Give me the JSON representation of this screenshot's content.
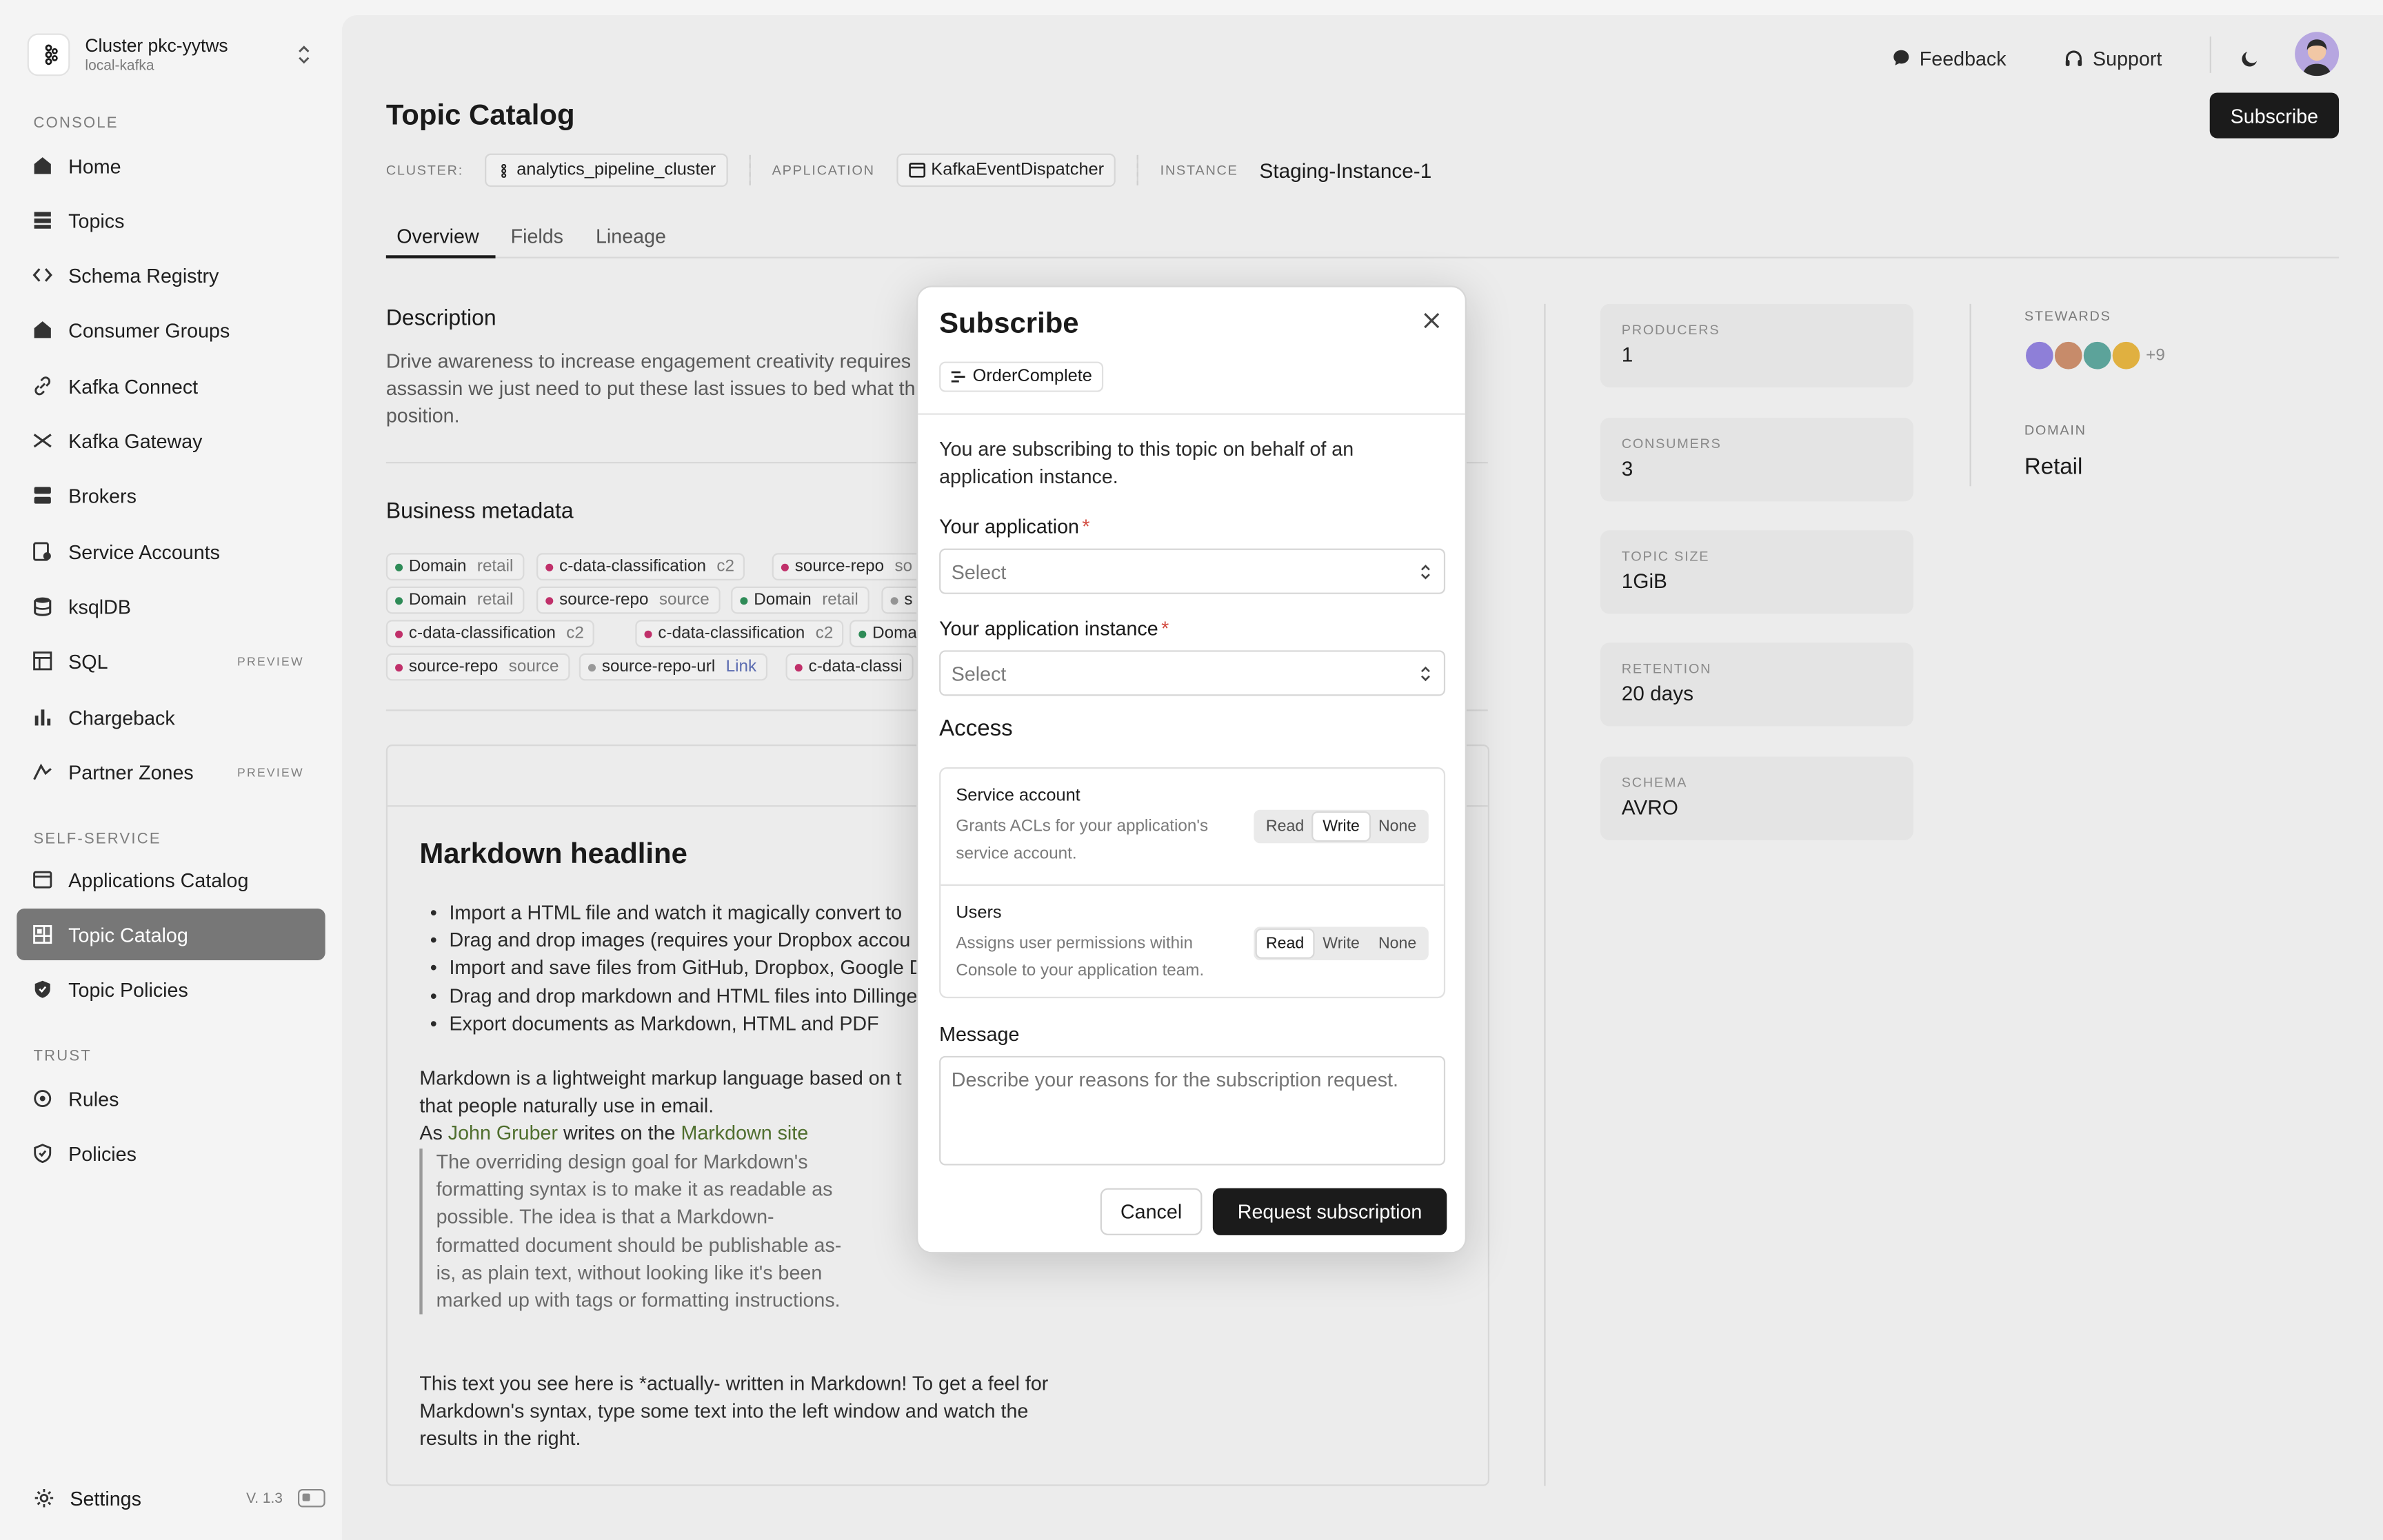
{
  "sidebar": {
    "cluster_name": "Cluster pkc-yytws",
    "cluster_sub": "local-kafka",
    "section_console": "CONSOLE",
    "section_self_service": "SELF-SERVICE",
    "section_trust": "TRUST",
    "items": [
      {
        "label": "Home",
        "icon": "home-icon"
      },
      {
        "label": "Topics",
        "icon": "topics-icon"
      },
      {
        "label": "Schema Registry",
        "icon": "code-icon"
      },
      {
        "label": "Consumer Groups",
        "icon": "home-icon"
      },
      {
        "label": "Kafka Connect",
        "icon": "link-icon"
      },
      {
        "label": "Kafka Gateway",
        "icon": "gateway-icon"
      },
      {
        "label": "Brokers",
        "icon": "brokers-icon"
      },
      {
        "label": "Service Accounts",
        "icon": "service-account-icon"
      },
      {
        "label": "ksqlDB",
        "icon": "database-icon"
      },
      {
        "label": "SQL",
        "icon": "table-icon",
        "badge": "PREVIEW"
      },
      {
        "label": "Chargeback",
        "icon": "bar-chart-icon"
      },
      {
        "label": "Partner Zones",
        "icon": "partner-icon",
        "badge": "PREVIEW"
      },
      {
        "label": "Applications Catalog",
        "icon": "window-icon"
      },
      {
        "label": "Topic Catalog",
        "icon": "grid-icon",
        "active": true
      },
      {
        "label": "Topic Policies",
        "icon": "shield-icon"
      },
      {
        "label": "Rules",
        "icon": "rules-icon"
      },
      {
        "label": "Policies",
        "icon": "shield-check-icon"
      }
    ],
    "settings_label": "Settings",
    "version": "V. 1.3"
  },
  "topbar": {
    "feedback": "Feedback",
    "support": "Support",
    "subscribe": "Subscribe"
  },
  "page": {
    "title": "Topic Catalog",
    "cluster_key": "CLUSTER:",
    "cluster_val": "analytics_pipeline_cluster",
    "application_key": "APPLICATION",
    "application_val": "KafkaEventDispatcher",
    "instance_key": "INSTANCE",
    "instance_val": "Staging-Instance-1",
    "tabs": [
      "Overview",
      "Fields",
      "Lineage"
    ],
    "description_heading": "Description",
    "description_text": "Drive awareness to increase engagement creativity requires assassin we just need to put these last issues to bed what this position.",
    "business_heading": "Business metadata",
    "tags": [
      {
        "k": "Domain",
        "v": "retail",
        "color": "#2e8b57"
      },
      {
        "k": "c-data-classification",
        "v": "c2",
        "color": "#c0306a"
      },
      {
        "k": "source-repo",
        "v": "so",
        "color": "#c0306a"
      },
      {
        "k": "Domain",
        "v": "retail",
        "color": "#2e8b57"
      },
      {
        "k": "source-repo",
        "v": "source",
        "color": "#c0306a"
      },
      {
        "k": "Domain",
        "v": "retail",
        "color": "#2e8b57"
      },
      {
        "k": "s",
        "v": "",
        "color": "#999999"
      },
      {
        "k": "c-data-classification",
        "v": "c2",
        "color": "#c0306a"
      },
      {
        "k": "c-data-classification",
        "v": "c2",
        "color": "#c0306a"
      },
      {
        "k": "Doma",
        "v": "",
        "color": "#2e8b57"
      },
      {
        "k": "source-repo",
        "v": "source",
        "color": "#c0306a"
      },
      {
        "k": "source-repo-url",
        "v": "Link",
        "color": "#999999"
      },
      {
        "k": "c-data-classi",
        "v": "",
        "color": "#c0306a"
      }
    ],
    "md_heading": "Markdown headline",
    "md_list": [
      "Import a HTML file and watch it magically convert to",
      "Drag and drop images (requires your Dropbox accou",
      "Import and save files from GitHub, Dropbox, Google D",
      "Drag and drop markdown and HTML files into Dillinge",
      "Export documents as Markdown, HTML and PDF"
    ],
    "md_para1": "Markdown is a lightweight markup language based on t",
    "md_para1b": "that people naturally use in email.",
    "md_as": "As",
    "md_gruber": "John Gruber",
    "md_writes": "writes on the",
    "md_site": "Markdown site",
    "md_quote": "The overriding design goal for Markdown's formatting syntax is to make it as readable as possible. The idea is that a Markdown-formatted document should be publishable as-is, as plain text, without looking like it's been marked up with tags or formatting instructions.",
    "md_para2": "This text you see here is *actually- written in Markdown! To get a feel for Markdown's syntax, type some text into the left window and watch the results in the right."
  },
  "stats": [
    {
      "k": "PRODUCERS",
      "v": "1"
    },
    {
      "k": "CONSUMERS",
      "v": "3"
    },
    {
      "k": "TOPIC SIZE",
      "v": "1GiB"
    },
    {
      "k": "RETENTION",
      "v": "20 days"
    },
    {
      "k": "SCHEMA",
      "v": "AVRO"
    }
  ],
  "side": {
    "stewards_key": "STEWARDS",
    "stewards_more": "+9",
    "domain_key": "DOMAIN",
    "domain_val": "Retail"
  },
  "modal": {
    "title": "Subscribe",
    "topic_chip": "OrderComplete",
    "intro": "You are subscribing to this topic on behalf of an application instance.",
    "app_label": "Your application",
    "app_placeholder": "Select",
    "instance_label": "Your application instance",
    "instance_placeholder": "Select",
    "required_mark": "*",
    "access_heading": "Access",
    "service_title": "Service account",
    "service_desc": "Grants ACLs for your application's service account.",
    "users_title": "Users",
    "users_desc": "Assigns user permissions within Console to your application team.",
    "options": [
      "Read",
      "Write",
      "None"
    ],
    "service_selected": "Write",
    "users_selected": "Read",
    "message_label": "Message",
    "message_placeholder": "Describe your reasons for the subscription request.",
    "cancel": "Cancel",
    "request": "Request subscription"
  }
}
